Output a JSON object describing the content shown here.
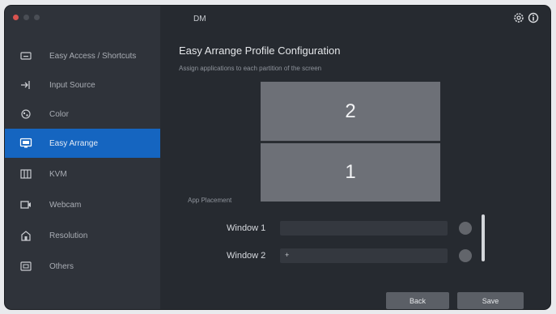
{
  "window": {
    "title": "DM"
  },
  "sidebar": {
    "items": [
      {
        "label": "Easy Access / Shortcuts",
        "icon": "keyboard-icon"
      },
      {
        "label": "Input Source",
        "icon": "input-source-icon"
      },
      {
        "label": "Color",
        "icon": "color-icon"
      },
      {
        "label": "Easy Arrange",
        "icon": "easy-arrange-icon",
        "active": true
      },
      {
        "label": "KVM",
        "icon": "kvm-icon"
      },
      {
        "label": "Webcam",
        "icon": "webcam-icon"
      },
      {
        "label": "Resolution",
        "icon": "resolution-icon"
      },
      {
        "label": "Others",
        "icon": "others-icon"
      }
    ]
  },
  "header": {
    "settings_icon": "gear-icon",
    "info_icon": "info-icon"
  },
  "main": {
    "title": "Easy Arrange Profile Configuration",
    "subtitle": "Assign applications to each partition of the screen",
    "monitors": [
      "2",
      "1"
    ],
    "section_label": "App Placement",
    "windows": [
      {
        "label": "Window 1",
        "value": ""
      },
      {
        "label": "Window 2",
        "value": "+"
      }
    ],
    "buttons": {
      "back": "Back",
      "save": "Save"
    }
  },
  "colors": {
    "accent": "#1565c0",
    "window_bg": "#262a30",
    "sidebar_bg": "#2f333a",
    "monitor": "#6d7077"
  }
}
